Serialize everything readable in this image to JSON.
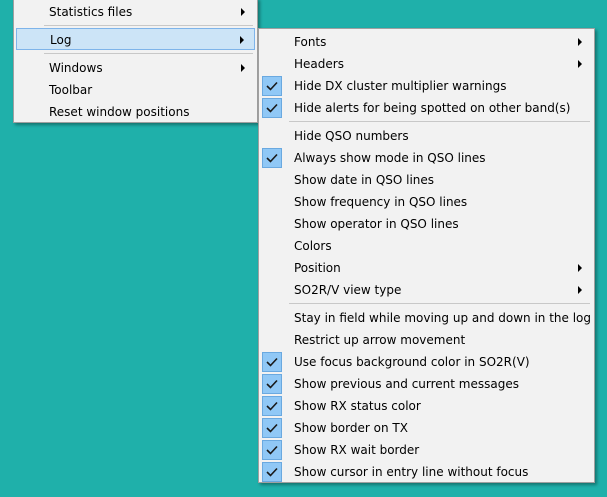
{
  "main_menu": {
    "items": [
      {
        "label": "Statistics files",
        "submenu": true
      },
      {
        "label": "Log",
        "submenu": true,
        "highlighted": true
      },
      {
        "label": "Windows",
        "submenu": true
      },
      {
        "label": "Toolbar",
        "submenu": false
      },
      {
        "label": "Reset window positions",
        "submenu": false
      }
    ]
  },
  "log_submenu": {
    "items": [
      {
        "label": "Fonts",
        "submenu": true,
        "checked": false
      },
      {
        "label": "Headers",
        "submenu": true,
        "checked": false
      },
      {
        "label": "Hide DX cluster multiplier warnings",
        "checked": true
      },
      {
        "label": "Hide alerts for being spotted on other band(s)",
        "checked": true
      },
      {
        "label": "Hide QSO numbers",
        "checked": false
      },
      {
        "label": "Always show mode in QSO lines",
        "checked": true
      },
      {
        "label": "Show date in QSO lines",
        "checked": false
      },
      {
        "label": "Show frequency in QSO lines",
        "checked": false
      },
      {
        "label": "Show operator in QSO lines",
        "checked": false
      },
      {
        "label": "Colors",
        "checked": false
      },
      {
        "label": "Position",
        "submenu": true,
        "checked": false
      },
      {
        "label": "SO2R/V view type",
        "submenu": true,
        "checked": false
      },
      {
        "label": "Stay in field while moving up and down in the log",
        "checked": false
      },
      {
        "label": "Restrict up arrow movement",
        "checked": false
      },
      {
        "label": "Use focus background color in SO2R(V)",
        "checked": true
      },
      {
        "label": "Show previous and current messages",
        "checked": true
      },
      {
        "label": "Show RX status color",
        "checked": true
      },
      {
        "label": "Show border on TX",
        "checked": true
      },
      {
        "label": "Show RX wait border",
        "checked": true
      },
      {
        "label": "Show cursor in entry line without focus",
        "checked": true
      }
    ]
  },
  "icons": {
    "check": "checkmark-icon",
    "submenu_arrow": "chevron-right-icon"
  },
  "colors": {
    "desktop": "#1fb0aa",
    "menu_bg": "#f2f2f2",
    "highlight": "#cce4f7",
    "check_bg": "#90c8f6"
  }
}
